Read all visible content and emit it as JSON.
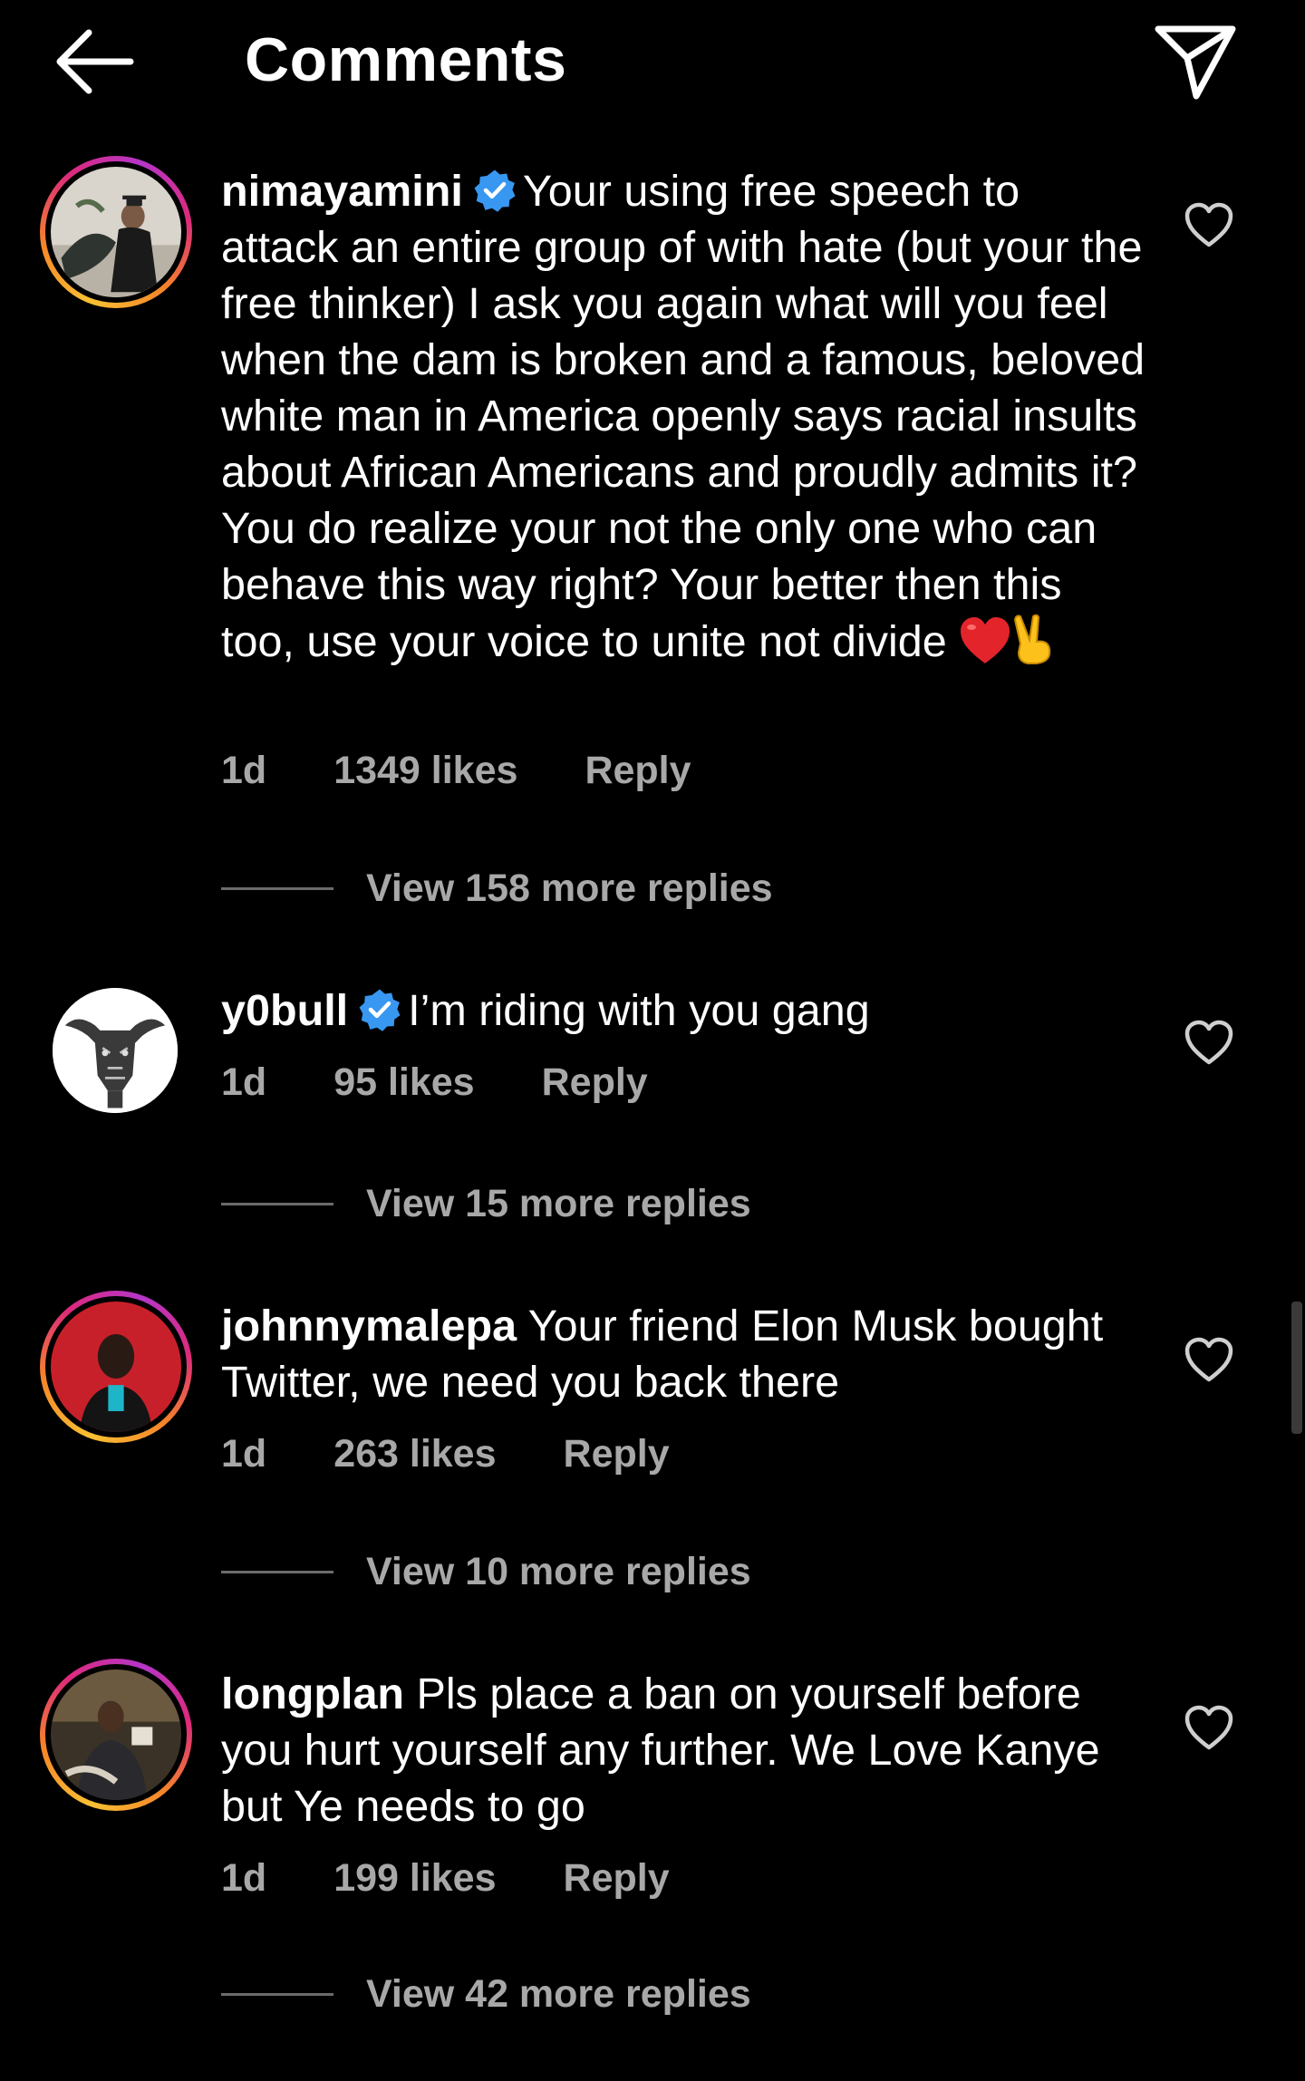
{
  "header": {
    "title": "Comments"
  },
  "comments": [
    {
      "username": "nimayamini",
      "verified": true,
      "text": "Your using free speech to attack an entire group of with hate (but your the free thinker) I ask you again what will you feel when the dam is broken and a famous, beloved white man in America openly says racial insults about African Americans  and proudly admits it? You do realize your not the only one who can behave this way right? Your better then this too, use your voice to unite not divide",
      "emojis": [
        "red-heart",
        "victory-hand"
      ],
      "time": "1d",
      "likes": "1349 likes",
      "reply_label": "Reply",
      "view_replies": "View 158 more replies"
    },
    {
      "username": "y0bull",
      "verified": true,
      "text": "I’m riding with you gang",
      "time": "1d",
      "likes": "95 likes",
      "reply_label": "Reply",
      "view_replies": "View 15 more replies"
    },
    {
      "username": "johnnymalepa",
      "verified": false,
      "text": "Your friend Elon Musk bought Twitter, we need you back there",
      "time": "1d",
      "likes": "263 likes",
      "reply_label": "Reply",
      "view_replies": "View 10 more replies"
    },
    {
      "username": "longplan",
      "verified": false,
      "text": "Pls place a ban on yourself before you hurt yourself any further. We Love Kanye but Ye needs to go",
      "time": "1d",
      "likes": "199 likes",
      "reply_label": "Reply",
      "view_replies": "View 42 more replies"
    }
  ],
  "colors": {
    "background": "#000000",
    "text": "#ffffff",
    "secondary_text": "#a8a8a8",
    "verified_badge": "#3897f0",
    "story_ring": [
      "#f9c033",
      "#f58529",
      "#dd2a7b",
      "#b536c9"
    ]
  }
}
